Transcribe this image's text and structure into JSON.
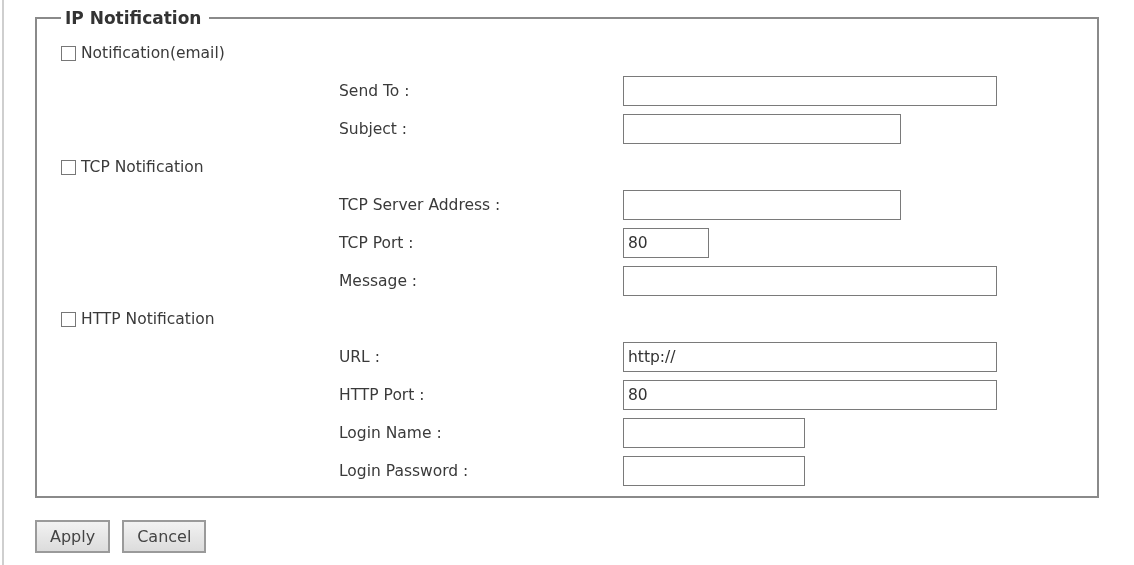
{
  "legend": "IP Notification",
  "sections": [
    {
      "label": "Notification(email)",
      "checked": false,
      "fields": [
        {
          "label": "Send To :"
        },
        {
          "label": "Subject :"
        }
      ]
    },
    {
      "label": "TCP Notification",
      "checked": false,
      "fields": [
        {
          "label": "TCP Server Address :"
        },
        {
          "label": "TCP Port :",
          "value": "80"
        },
        {
          "label": "Message :"
        }
      ]
    },
    {
      "label": "HTTP Notification",
      "checked": false,
      "fields": [
        {
          "label": "URL :",
          "value": "http://"
        },
        {
          "label": "HTTP Port :",
          "value": "80"
        },
        {
          "label": "Login Name :"
        },
        {
          "label": "Login Password :"
        }
      ]
    }
  ],
  "buttons": [
    "Apply",
    "Cancel"
  ]
}
